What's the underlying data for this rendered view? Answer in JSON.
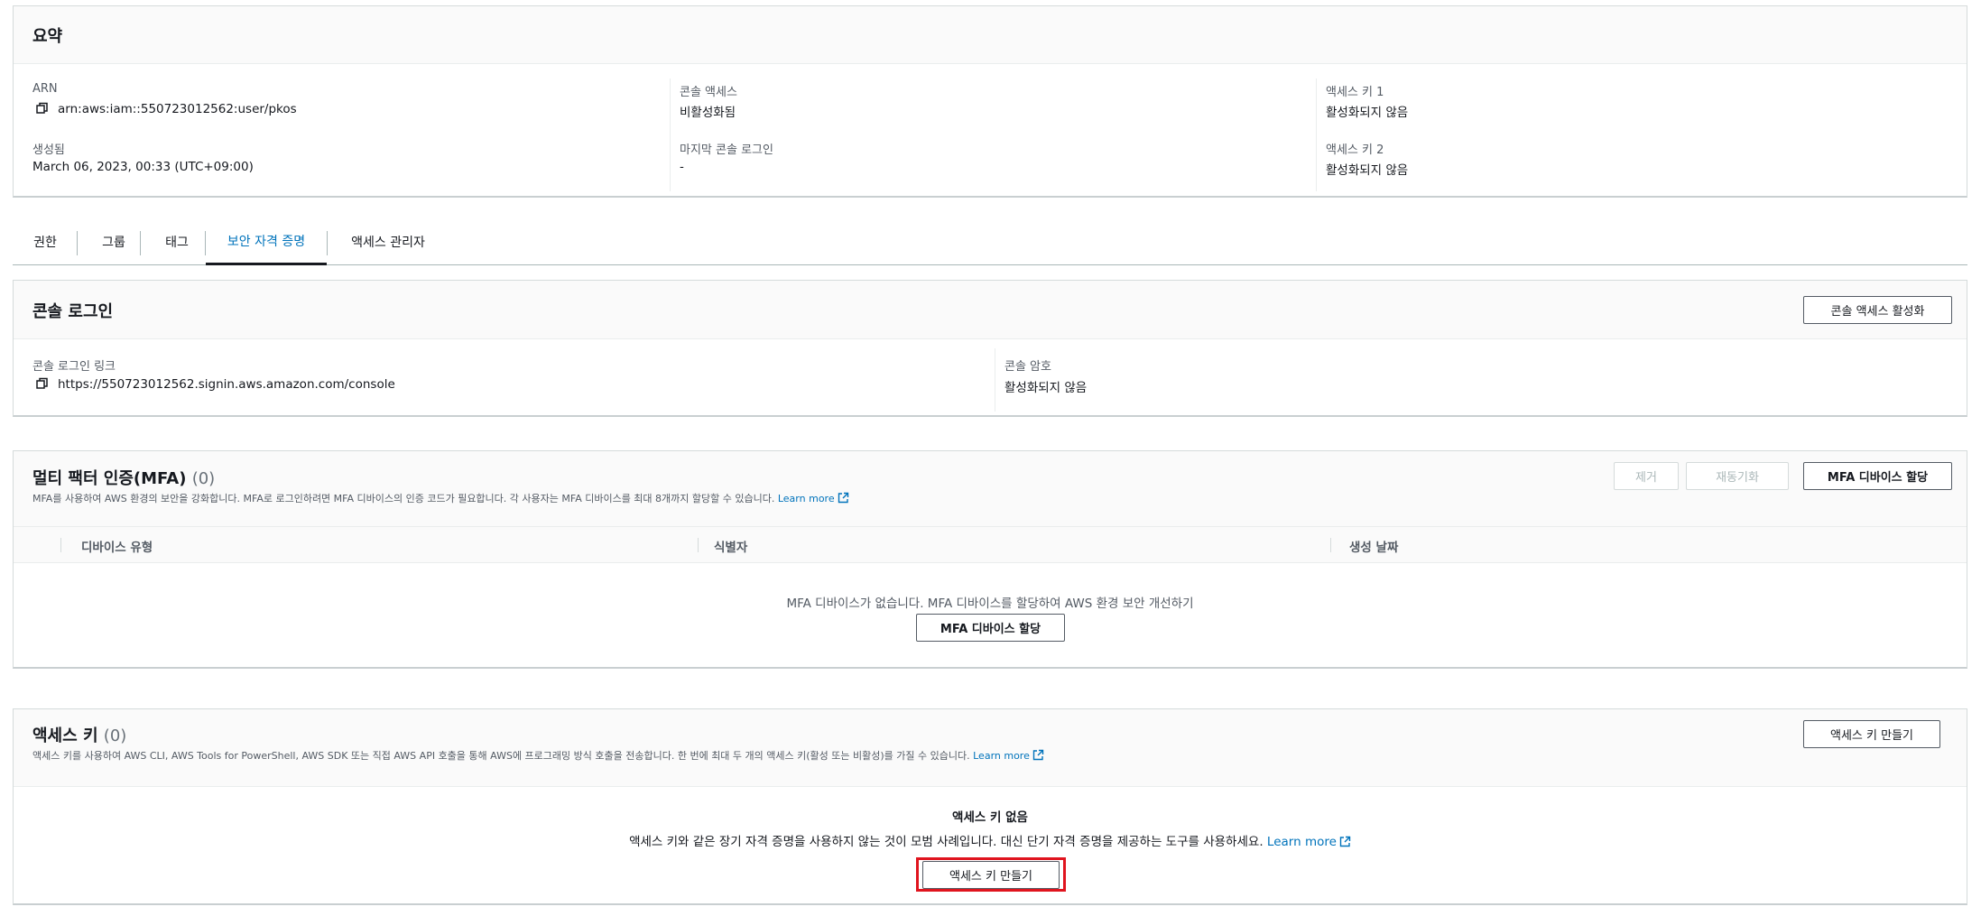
{
  "summary": {
    "title": "요약",
    "arn_label": "ARN",
    "arn_value": "arn:aws:iam::550723012562:user/pkos",
    "created_label": "생성됨",
    "created_value": "March 06, 2023, 00:33 (UTC+09:00)",
    "console_access_label": "콘솔 액세스",
    "console_access_value": "비활성화됨",
    "last_login_label": "마지막 콘솔 로그인",
    "last_login_value": "-",
    "key1_label": "액세스 키 1",
    "key1_value": "활성화되지 않음",
    "key2_label": "액세스 키 2",
    "key2_value": "활성화되지 않음"
  },
  "tabs": [
    {
      "label": "권한"
    },
    {
      "label": "그룹"
    },
    {
      "label": "태그"
    },
    {
      "label": "보안 자격 증명"
    },
    {
      "label": "액세스 관리자"
    }
  ],
  "console_login": {
    "title": "콘솔 로그인",
    "enable_button": "콘솔 액세스 활성화",
    "link_label": "콘솔 로그인 링크",
    "link_value": "https://550723012562.signin.aws.amazon.com/console",
    "password_label": "콘솔 암호",
    "password_value": "활성화되지 않음"
  },
  "mfa": {
    "title": "멀티 팩터 인증(MFA)",
    "count": "(0)",
    "description": "MFA를 사용하여 AWS 환경의 보안을 강화합니다. MFA로 로그인하려면 MFA 디바이스의 인증 코드가 필요합니다. 각 사용자는 MFA 디바이스를 최대 8개까지 할당할 수 있습니다.",
    "learn_more": "Learn more",
    "remove_button": "제거",
    "resync_button": "재동기화",
    "assign_button": "MFA 디바이스 할당",
    "columns": [
      "디바이스 유형",
      "식별자",
      "생성 날짜"
    ],
    "empty_text": "MFA 디바이스가 없습니다. MFA 디바이스를 할당하여 AWS 환경 보안 개선하기",
    "empty_assign_button": "MFA 디바이스 할당"
  },
  "access_keys": {
    "title": "액세스 키",
    "count": "(0)",
    "description": "액세스 키를 사용하여 AWS CLI, AWS Tools for PowerShell, AWS SDK 또는 직접 AWS API 호출을 통해 AWS에 프로그래밍 방식 호출을 전송합니다. 한 번에 최대 두 개의 액세스 키(활성 또는 비활성)를 가질 수 있습니다.",
    "learn_more": "Learn more",
    "create_button": "액세스 키 만들기",
    "empty_title": "액세스 키 없음",
    "empty_text": "액세스 키와 같은 장기 자격 증명을 사용하지 않는 것이 모범 사례입니다. 대신 단기 자격 증명을 제공하는 도구를 사용하세요.",
    "empty_learn_more": "Learn more",
    "empty_create_button": "액세스 키 만들기"
  },
  "colors": {
    "link": "#0073bb",
    "highlight": "#e0141e",
    "text": "#16191f",
    "muted": "#545b64"
  }
}
